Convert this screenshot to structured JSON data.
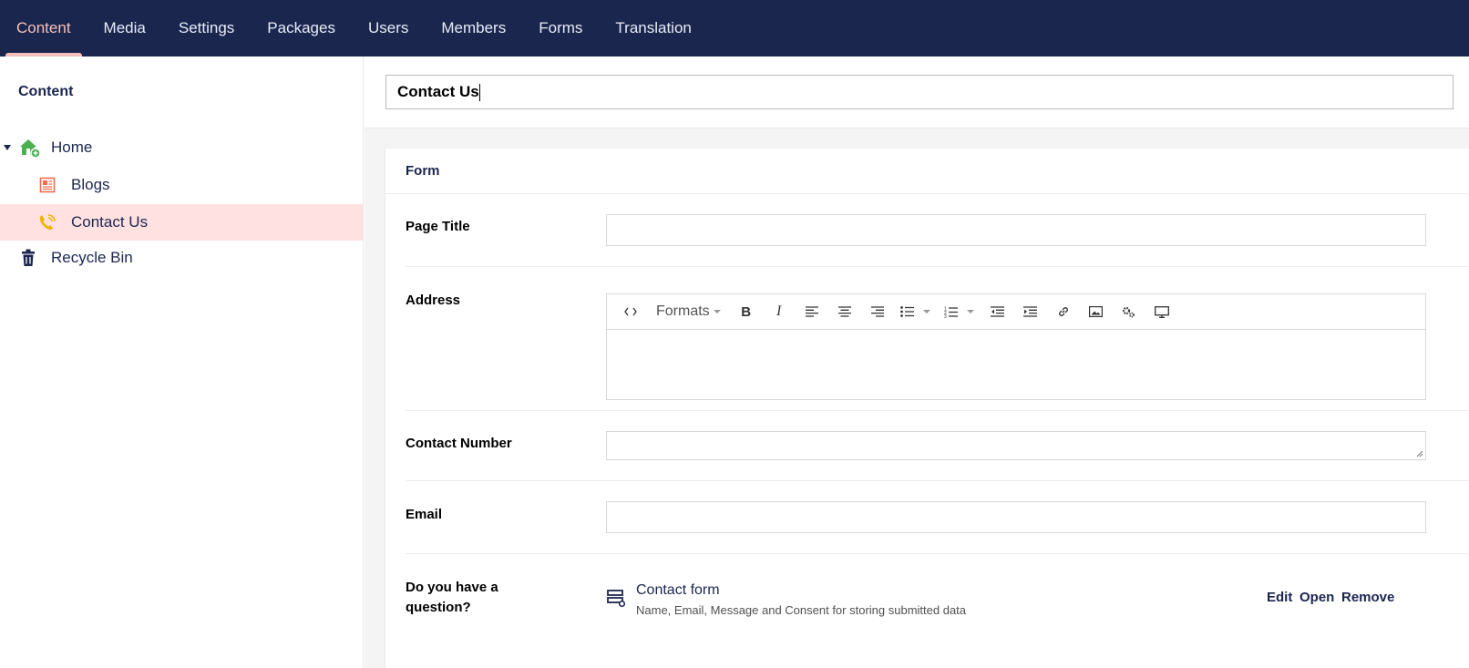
{
  "nav": {
    "items": [
      {
        "label": "Content",
        "active": true
      },
      {
        "label": "Media"
      },
      {
        "label": "Settings"
      },
      {
        "label": "Packages"
      },
      {
        "label": "Users"
      },
      {
        "label": "Members"
      },
      {
        "label": "Forms"
      },
      {
        "label": "Translation"
      }
    ]
  },
  "sidebar": {
    "title": "Content",
    "tree": [
      {
        "label": "Home",
        "icon": "home-icon"
      },
      {
        "label": "Blogs",
        "icon": "blog-icon"
      },
      {
        "label": "Contact Us",
        "icon": "phone-icon",
        "selected": true
      },
      {
        "label": "Recycle Bin",
        "icon": "trash-icon"
      }
    ]
  },
  "editor": {
    "node_name": "Contact Us",
    "group_title": "Form",
    "properties": {
      "page_title": {
        "label": "Page Title",
        "value": ""
      },
      "address": {
        "label": "Address",
        "value": ""
      },
      "contact_number": {
        "label": "Contact Number",
        "value": ""
      },
      "email": {
        "label": "Email",
        "value": ""
      },
      "question": {
        "label": "Do you have a question?"
      }
    },
    "rte_toolbar": {
      "formats_label": "Formats",
      "buttons": [
        "source-code-icon",
        "bold-icon",
        "italic-icon",
        "align-left-icon",
        "align-center-icon",
        "align-right-icon",
        "bullet-list-icon",
        "numbered-list-icon",
        "outdent-icon",
        "indent-icon",
        "link-icon",
        "image-icon",
        "macro-icon",
        "embed-icon"
      ]
    },
    "form_picker": {
      "name": "Contact form",
      "description": "Name, Email, Message and Consent for storing submitted data",
      "edit_label": "Edit",
      "open_label": "Open",
      "remove_label": "Remove"
    }
  },
  "colors": {
    "nav_bg": "#1b264f",
    "nav_active": "#f5c1bc",
    "selected_bg": "#ffe1e1",
    "home_icon": "#4caf50",
    "blog_icon": "#f26d50",
    "phone_icon": "#f5b300"
  }
}
